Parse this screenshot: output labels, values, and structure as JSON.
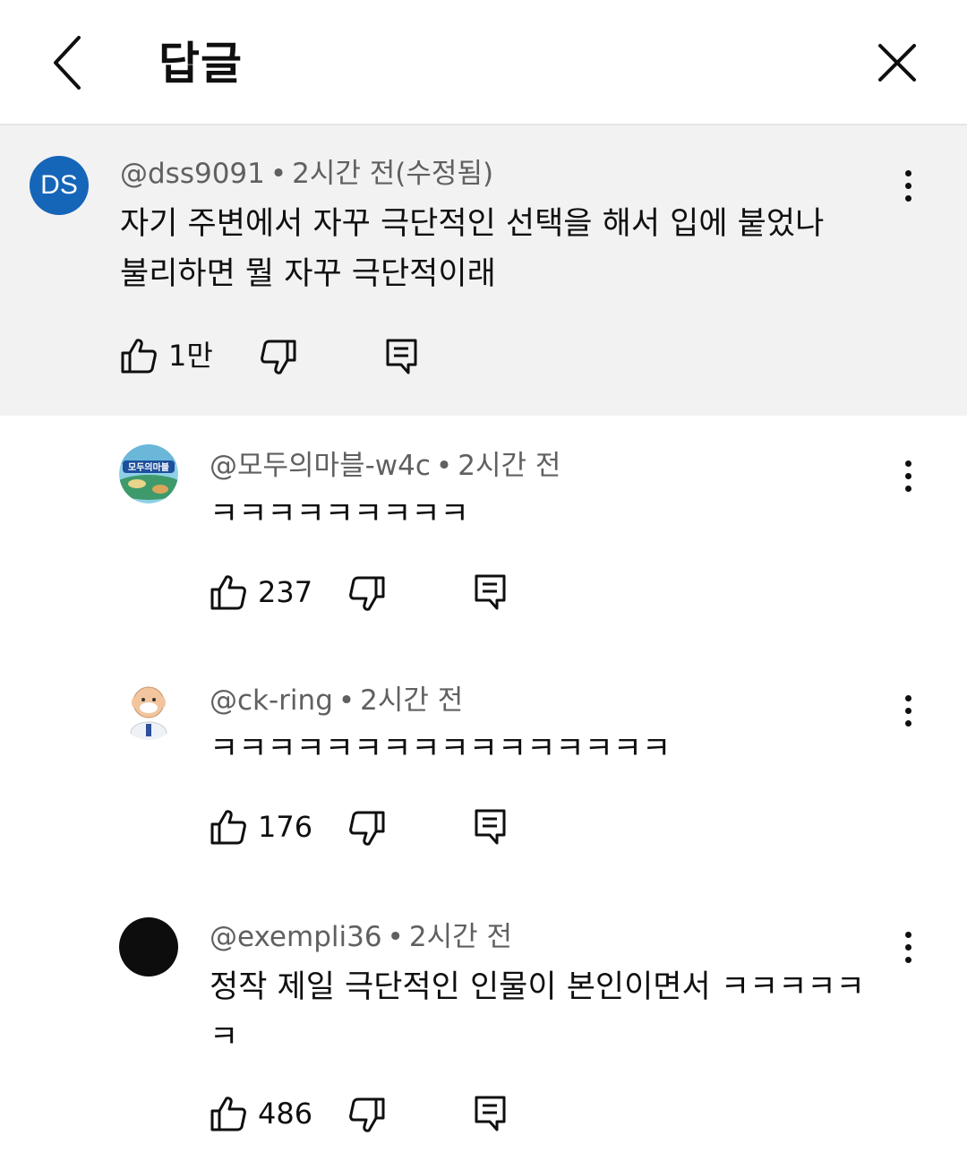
{
  "header": {
    "title": "답글"
  },
  "main_comment": {
    "avatar_initials": "DS",
    "author": "@dss9091",
    "time": "2시간 전(수정됨)",
    "line1": "자기 주변에서 자꾸 극단적인 선택을 해서 입에 붙었나",
    "line2": "불리하면 뭘 자꾸 극단적이래",
    "likes": "1만"
  },
  "replies": [
    {
      "author": "@모두의마블-w4c",
      "time": "2시간 전",
      "line1": "ㅋㅋㅋㅋㅋㅋㅋㅋㅋ",
      "likes": "237",
      "avatar_text": "모두의마블"
    },
    {
      "author": "@ck-ring",
      "time": "2시간 전",
      "line1": "ㅋㅋㅋㅋㅋㅋㅋㅋㅋㅋㅋㅋㅋㅋㅋㅋ",
      "likes": "176"
    },
    {
      "author": "@exempli36",
      "time": "2시간 전",
      "line1": "정작 제일 극단적인 인물이 본인이면서 ㅋㅋㅋㅋㅋ",
      "line2": "ㅋ",
      "likes": "486"
    }
  ],
  "separator": "•",
  "icons": {
    "back": "chevron-left-icon",
    "close": "close-icon",
    "more": "more-vert-icon",
    "like": "thumb-up-icon",
    "dislike": "thumb-down-icon",
    "reply": "reply-icon"
  },
  "colors": {
    "avatar_ds": "#1565b8",
    "highlight_bg": "#f2f2f2",
    "meta_text": "#606060"
  }
}
